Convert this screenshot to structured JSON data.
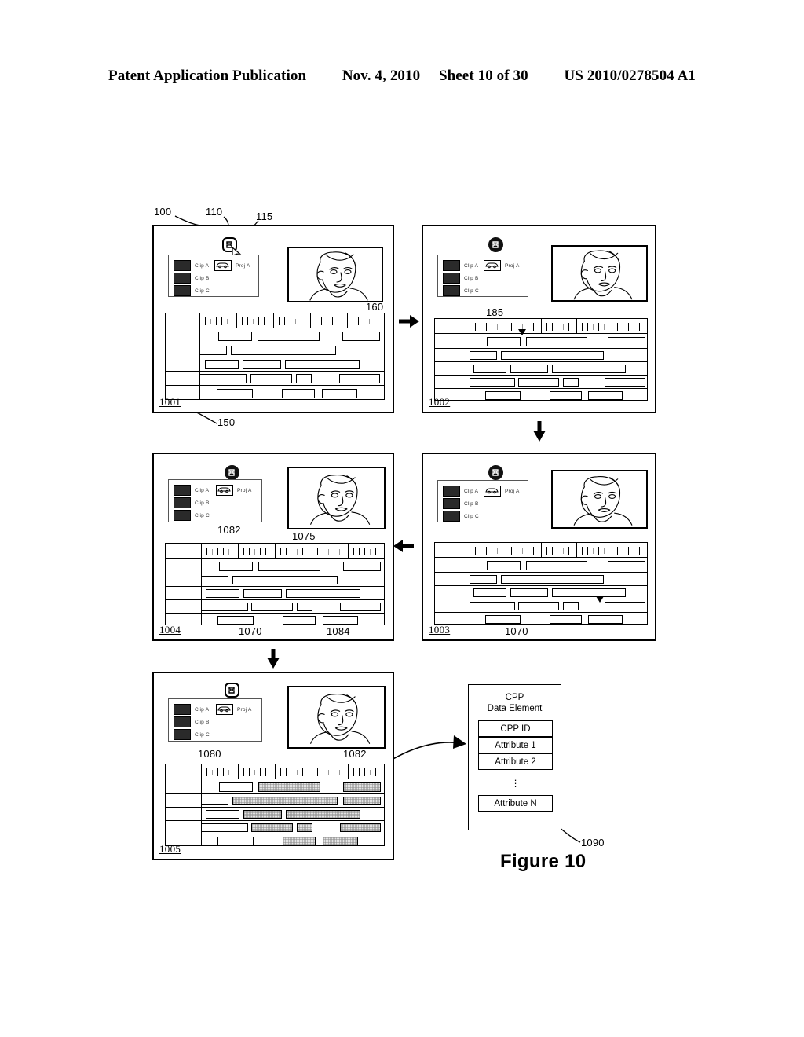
{
  "header": {
    "publication": "Patent Application Publication",
    "date": "Nov. 4, 2010",
    "sheet": "Sheet 10 of 30",
    "patent_number": "US 2010/0278504 A1"
  },
  "figure": {
    "caption": "Figure 10"
  },
  "panels": [
    {
      "id": "1001",
      "id_label": "1001",
      "callouts": [
        "100",
        "110",
        "115",
        "160",
        "150"
      ]
    },
    {
      "id": "1002",
      "id_label": "1002",
      "callouts": [
        "185"
      ]
    },
    {
      "id": "1003",
      "id_label": "1003",
      "callouts": [
        "1070"
      ]
    },
    {
      "id": "1004",
      "id_label": "1004",
      "callouts": [
        "1082",
        "1075",
        "1070",
        "1084"
      ]
    },
    {
      "id": "1005",
      "id_label": "1005",
      "callouts": [
        "1080",
        "1082"
      ]
    }
  ],
  "callout_labels": {
    "n100": "100",
    "n110": "110",
    "n115": "115",
    "n150": "150",
    "n160": "160",
    "n185": "185",
    "n1070_p1003": "1070",
    "n1070_p1004": "1070",
    "n1075": "1075",
    "n1082_p1004": "1082",
    "n1084": "1084",
    "n1080": "1080",
    "n1082_p1005": "1082",
    "n1090": "1090"
  },
  "clip_browser": {
    "clips": [
      {
        "label": "Clip A",
        "icon": "car-thumbnail-icon"
      },
      {
        "label": "Clip B",
        "icon": "person-thumbnail-icon"
      },
      {
        "label": "Clip C",
        "icon": "landscape-thumbnail-icon"
      }
    ],
    "projects": [
      {
        "label": "Proj A",
        "icon": "car-outline-icon"
      }
    ]
  },
  "toolbar": {
    "button_name": "compound-clip-button"
  },
  "cpp": {
    "title_line_1": "CPP",
    "title_line_2": "Data Element",
    "fields": [
      "CPP ID",
      "Attribute 1",
      "Attribute 2",
      "Attribute N"
    ],
    "ellipsis": "⋮",
    "reference": "1090"
  },
  "flow_arrows": [
    {
      "name": "arrow-1001-to-1002",
      "direction": "right"
    },
    {
      "name": "arrow-1002-to-1003",
      "direction": "down"
    },
    {
      "name": "arrow-1003-to-1004",
      "direction": "left"
    },
    {
      "name": "arrow-1004-to-1005",
      "direction": "down"
    },
    {
      "name": "arrow-1005-to-cpp",
      "direction": "right"
    }
  ],
  "timeline": {
    "track_count": 5,
    "ruler_segments": 5,
    "header_column_label": ""
  },
  "colors": {
    "ink": "#000000",
    "shade": "#e3e3e3",
    "hatch": "#8a8a8a",
    "paper": "#ffffff"
  }
}
